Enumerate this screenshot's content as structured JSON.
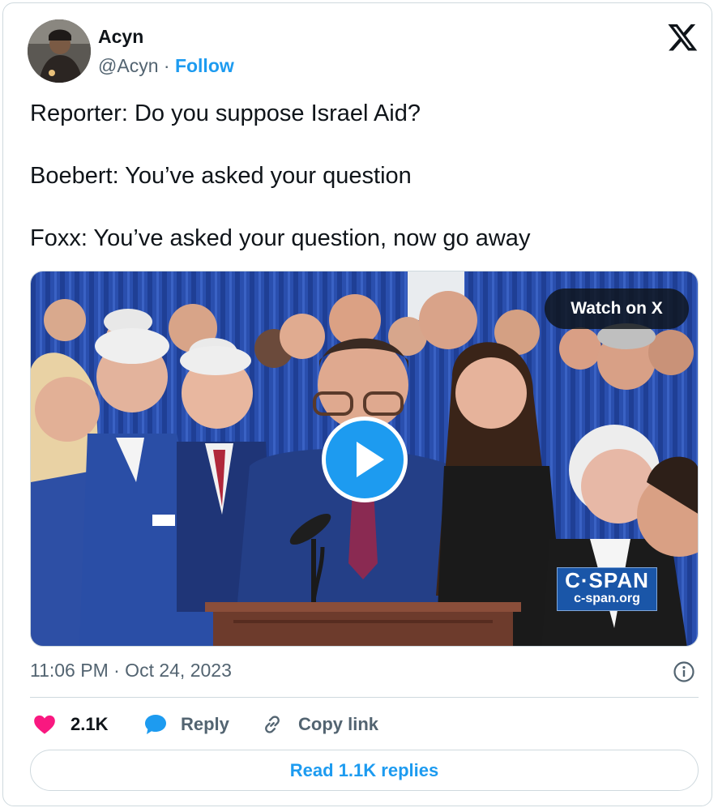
{
  "author": {
    "name": "Acyn",
    "handle": "@Acyn",
    "separator": "·",
    "follow_label": "Follow"
  },
  "tweet": {
    "lines": [
      "Reporter: Do you suppose Israel Aid?",
      "Boebert: You’ve asked your question",
      "Foxx: You’ve asked your question, now go away"
    ]
  },
  "media": {
    "watch_label": "Watch on X",
    "watermark_brand": "C·SPAN",
    "watermark_url": "c-span.org"
  },
  "meta": {
    "timestamp": "11:06 PM · Oct 24, 2023"
  },
  "actions": {
    "like_count": "2.1K",
    "reply_label": "Reply",
    "copy_label": "Copy link",
    "read_replies_label": "Read 1.1K replies"
  },
  "colors": {
    "accent": "#1d9bf0",
    "like": "#f91880",
    "secondary_text": "#536471",
    "border": "#cfd9de"
  },
  "icons": [
    "x-logo-icon",
    "play-icon",
    "heart-icon",
    "reply-bubble-icon",
    "link-icon",
    "info-icon"
  ]
}
